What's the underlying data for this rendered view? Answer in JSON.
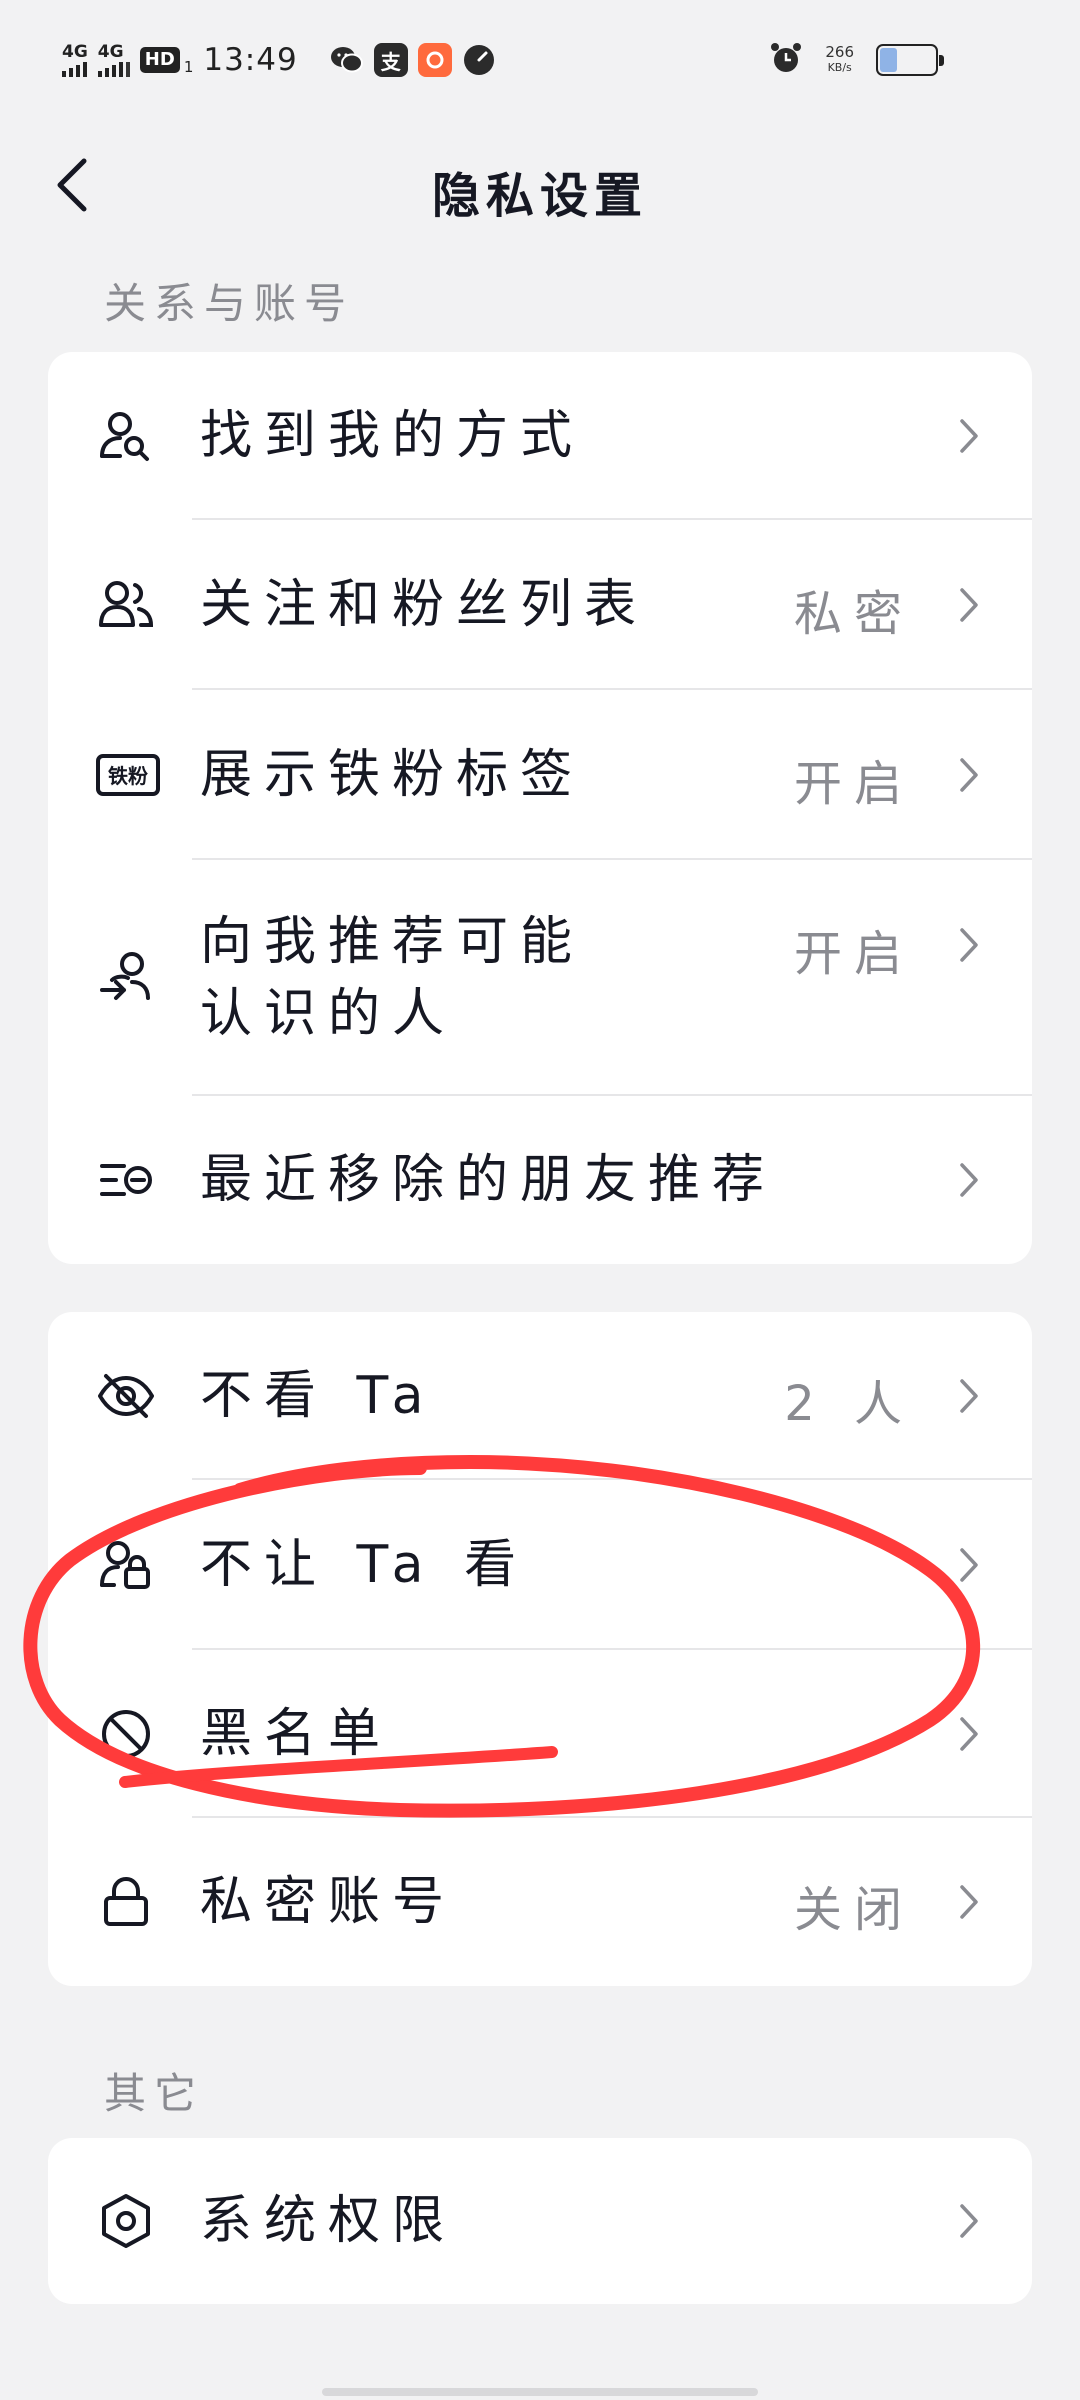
{
  "status_bar": {
    "network_1": "4G",
    "network_2": "4G",
    "hd_badge": "HD",
    "sim_index": "1",
    "time": "13:49",
    "alipay_glyph": "支",
    "speed_value": "266",
    "speed_unit": "KB/s",
    "battery_level": 0.32
  },
  "header": {
    "title": "隐私设置"
  },
  "sections": {
    "relationship_label": "关系与账号",
    "other_label": "其它"
  },
  "card1": {
    "find_me": {
      "label": "找到我的方式",
      "icon": "user-search-icon"
    },
    "follow_list": {
      "label": "关注和粉丝列表",
      "value": "私密",
      "icon": "users-icon"
    },
    "iron_fan": {
      "label": "展示铁粉标签",
      "value": "开启",
      "icon": "iron-fan-badge-icon",
      "badge_text": "铁粉"
    },
    "recommend": {
      "label_line1": "向我推荐可能",
      "label_line2": "认识的人",
      "value": "开启",
      "icon": "user-recommend-icon"
    },
    "removed": {
      "label": "最近移除的朋友推荐",
      "icon": "list-remove-icon"
    }
  },
  "card2": {
    "hide_ta": {
      "label": "不看 Ta",
      "value": "2 人",
      "icon": "eye-off-icon"
    },
    "block_view": {
      "label": "不让 Ta 看",
      "icon": "user-lock-icon"
    },
    "blacklist": {
      "label": "黑名单",
      "icon": "block-icon"
    },
    "private_account": {
      "label": "私密账号",
      "value": "关闭",
      "icon": "lock-icon"
    }
  },
  "card3": {
    "system_permissions": {
      "label": "系统权限",
      "icon": "settings-hexagon-icon"
    }
  },
  "colors": {
    "background": "#f2f2f3",
    "card": "#ffffff",
    "text_primary": "#161823",
    "text_secondary": "#8a8b91",
    "annotation_red": "#ff3b3b"
  }
}
